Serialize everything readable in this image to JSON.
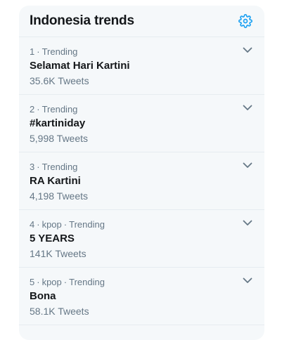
{
  "header": {
    "title": "Indonesia trends",
    "settings_icon": "gear-icon",
    "accent_color": "#1da1f2"
  },
  "trends": [
    {
      "rank": "1",
      "category": "",
      "label": "Trending",
      "name": "Selamat Hari Kartini",
      "count": "35.6K Tweets"
    },
    {
      "rank": "2",
      "category": "",
      "label": "Trending",
      "name": "#kartiniday",
      "count": "5,998 Tweets"
    },
    {
      "rank": "3",
      "category": "",
      "label": "Trending",
      "name": "RA Kartini",
      "count": "4,198 Tweets"
    },
    {
      "rank": "4",
      "category": "kpop",
      "label": "Trending",
      "name": "5 YEARS",
      "count": "141K Tweets"
    },
    {
      "rank": "5",
      "category": "kpop",
      "label": "Trending",
      "name": "Bona",
      "count": "58.1K Tweets"
    }
  ],
  "separator": "·",
  "chevron_icon": "chevron-down-icon"
}
